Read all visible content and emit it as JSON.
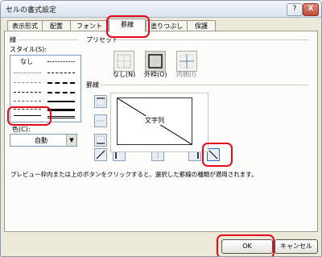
{
  "window": {
    "title": "セルの書式設定",
    "help": "?",
    "close": "X"
  },
  "tabs": [
    {
      "label": "表示形式"
    },
    {
      "label": "配置"
    },
    {
      "label": "フォント"
    },
    {
      "label": "罫線"
    },
    {
      "label": "塗りつぶし"
    },
    {
      "label": "保護"
    }
  ],
  "line_group": {
    "label": "線",
    "style_label": "スタイル(S):",
    "none_label": "なし",
    "color_label": "色(C):",
    "color_value": "自動"
  },
  "presets": {
    "label": "プリセット",
    "none_label": "なし(N)",
    "outline_label": "外枠(O)",
    "inside_label": "内側(I)"
  },
  "border_group": {
    "label": "罫線",
    "preview_text": "文字列"
  },
  "hint": "プレビュー枠内または上のボタンをクリックすると、選択した罫線の種類が適用されます。",
  "buttons": {
    "ok": "OK",
    "cancel": "キャンセル"
  },
  "colors": {
    "highlight": "#e8071b",
    "accent": "#316ac5"
  }
}
